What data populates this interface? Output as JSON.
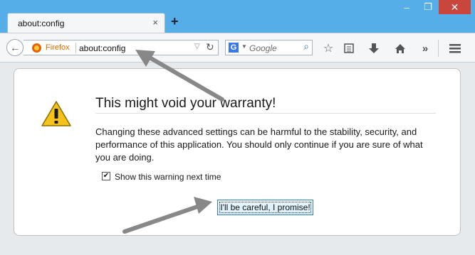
{
  "window": {
    "minimize": "‒",
    "restore": "❐",
    "close": "✕"
  },
  "tab": {
    "title": "about:config",
    "close": "×",
    "new_tab": "+"
  },
  "navbar": {
    "back_icon": "arrow-left-icon",
    "identity": "Firefox",
    "url": "about:config",
    "search_engine": "G",
    "search_placeholder": "Google",
    "toolbar_icons": [
      "star-icon",
      "bookmarks-menu-icon",
      "download-icon",
      "home-icon",
      "overflow-chevron-icon",
      "hamburger-menu-icon"
    ]
  },
  "page": {
    "heading": "This might void your warranty!",
    "body": "Changing these advanced settings can be harmful to the stability, security, and performance of this application. You should only continue if you are sure of what you are doing.",
    "checkbox_label": "Show this warning next time",
    "checkbox_checked": true,
    "button_label": "I'll be careful, I promise!"
  },
  "colors": {
    "frame": "#55aee8",
    "close_button": "#c9463d",
    "firefox_identity": "#d76b00",
    "annotation_arrow": "#888888"
  }
}
